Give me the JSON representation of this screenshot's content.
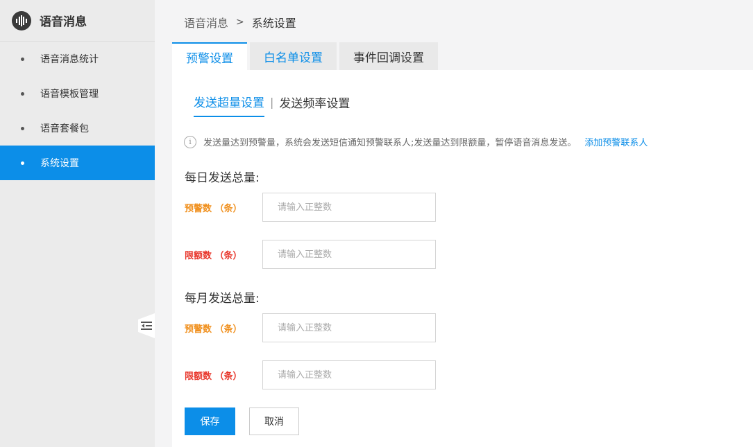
{
  "sidebar": {
    "title": "语音消息",
    "items": [
      {
        "label": "语音消息统计"
      },
      {
        "label": "语音模板管理"
      },
      {
        "label": "语音套餐包"
      },
      {
        "label": "系统设置",
        "active": true
      }
    ]
  },
  "breadcrumb": {
    "parent": "语音消息",
    "separator": ">",
    "current": "系统设置"
  },
  "tabs": [
    {
      "label": "预警设置"
    },
    {
      "label": "白名单设置"
    },
    {
      "label": "事件回调设置"
    }
  ],
  "subtabs": {
    "active": "发送超量设置",
    "separator": "|",
    "other": "发送频率设置"
  },
  "notice": {
    "text": "发送量达到预警量，系统会发送短信通知预警联系人;发送量达到限额量，暂停语音消息发送。",
    "link": "添加预警联系人"
  },
  "daily": {
    "title": "每日发送总量:",
    "warn_label": "预警数 （条）",
    "limit_label": "限额数 （条）",
    "warn_placeholder": "请输入正整数",
    "limit_placeholder": "请输入正整数"
  },
  "monthly": {
    "title": "每月发送总量:",
    "warn_label": "预警数 （条）",
    "limit_label": "限额数 （条）",
    "warn_placeholder": "请输入正整数",
    "limit_placeholder": "请输入正整数"
  },
  "buttons": {
    "save": "保存",
    "cancel": "取消"
  },
  "colors": {
    "accent": "#0c8ee8",
    "warn": "#f0901e",
    "limit": "#e8372c"
  },
  "icons": {
    "brand": "sound-wave-icon",
    "notice": "info-icon",
    "collapse": "collapse-menu-icon"
  }
}
